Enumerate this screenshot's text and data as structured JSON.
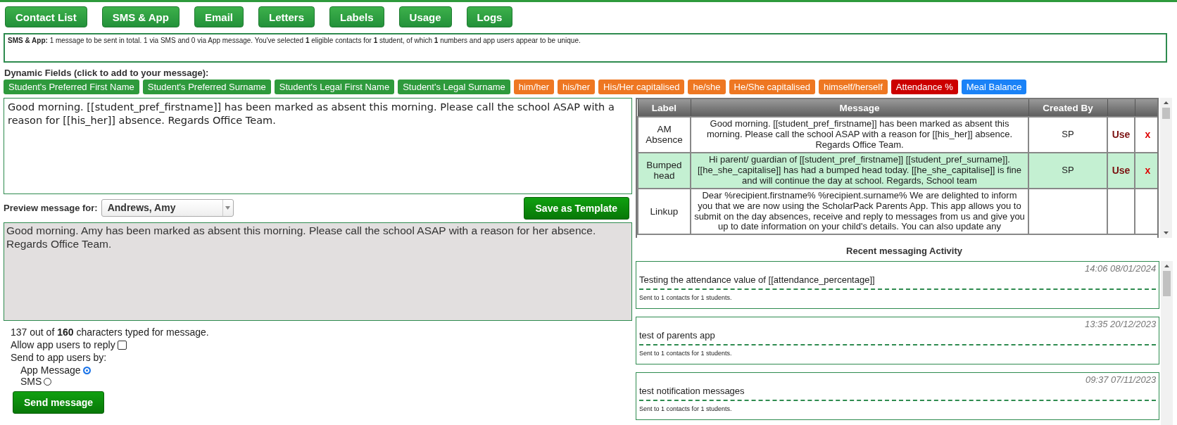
{
  "nav_buttons": [
    "Contact List",
    "SMS & App",
    "Email",
    "Letters",
    "Labels",
    "Usage",
    "Logs"
  ],
  "summary": "**SMS & App:** 1 message to be sent in total. 1 via SMS and 0 via App message. You've selected **1** eligible contacts for **1** student, of which **1** numbers and app users appear to be unique.",
  "dynamic_fields": {
    "label": "Dynamic Fields (click to add to your message):",
    "items": [
      {
        "label": "Student's Preferred First Name",
        "kind": "student"
      },
      {
        "label": "Student's Preferred Surname",
        "kind": "student"
      },
      {
        "label": "Student's Legal First Name",
        "kind": "student"
      },
      {
        "label": "Student's Legal Surname",
        "kind": "student"
      },
      {
        "label": "him/her",
        "kind": "pronoun"
      },
      {
        "label": "his/her",
        "kind": "pronoun"
      },
      {
        "label": "His/Her capitalised",
        "kind": "pronoun"
      },
      {
        "label": "he/she",
        "kind": "pronoun"
      },
      {
        "label": "He/She capitalised",
        "kind": "pronoun"
      },
      {
        "label": "himself/herself",
        "kind": "pronoun"
      },
      {
        "label": "Attendance %",
        "kind": "attendance"
      },
      {
        "label": "Meal Balance",
        "kind": "meal"
      }
    ]
  },
  "message": "Good morning. [[student_pref_firstname]] has been marked as absent this morning. Please call the school ASAP with a reason for [[his_her]] absence. Regards Office Team.",
  "preview": {
    "label": "Preview message for:",
    "recipient": "Andrews, Amy",
    "save_button": "Save as Template",
    "text": "Good morning. Amy has been marked as absent this morning. Please call the school ASAP with a reason for her absence. Regards Office Team."
  },
  "counter": "137 out of **160** characters typed for message.",
  "allow_reply": {
    "label": "Allow app users to reply",
    "checked": false
  },
  "send_by": {
    "label": "Send to app users by:",
    "options": [
      {
        "label": "App Message",
        "selected": true
      },
      {
        "label": "SMS",
        "selected": false
      }
    ]
  },
  "send_button": "Send message",
  "templates": {
    "columns": [
      "Label",
      "Message",
      "Created By"
    ],
    "rows": [
      {
        "label": "AM Absence",
        "message": "Good morning. [[student_pref_firstname]] has been marked as absent this morning. Please call the school ASAP with a reason for [[his_her]] absence. Regards Office Team.",
        "created_by": "SP",
        "use": "Use",
        "delete": "x",
        "selected": false
      },
      {
        "label": "Bumped head",
        "message": "Hi parent/ guardian of [[student_pref_firstname]] [[student_pref_surname]]. [[he_she_capitalise]] has had a bumped head today. [[he_she_capitalise]] is fine and will continue the day at school. Regards, School team",
        "created_by": "SP",
        "use": "Use",
        "delete": "x",
        "selected": true
      },
      {
        "label": "Linkup",
        "message": "Dear %recipient.firstname% %recipient.surname% We are delighted to inform you that we are now using the ScholarPack Parents App. This app allows you to submit on the day absences, receive and reply to messages from us and give you up to date information on your child's details. You can also update any",
        "selected": false
      }
    ]
  },
  "activity": {
    "title": "Recent messaging Activity",
    "items": [
      {
        "time": "14:06 08/01/2024",
        "message": "Testing the attendance value of [[attendance_percentage]]",
        "summary": "Sent to 1 contacts for 1 students."
      },
      {
        "time": "13:35 20/12/2023",
        "message": "test of parents app",
        "summary": "Sent to 1 contacts for 1 students."
      },
      {
        "time": "09:37 07/11/2023",
        "message": "test notification messages",
        "summary": "Sent to 1 contacts for 1 students."
      }
    ]
  }
}
